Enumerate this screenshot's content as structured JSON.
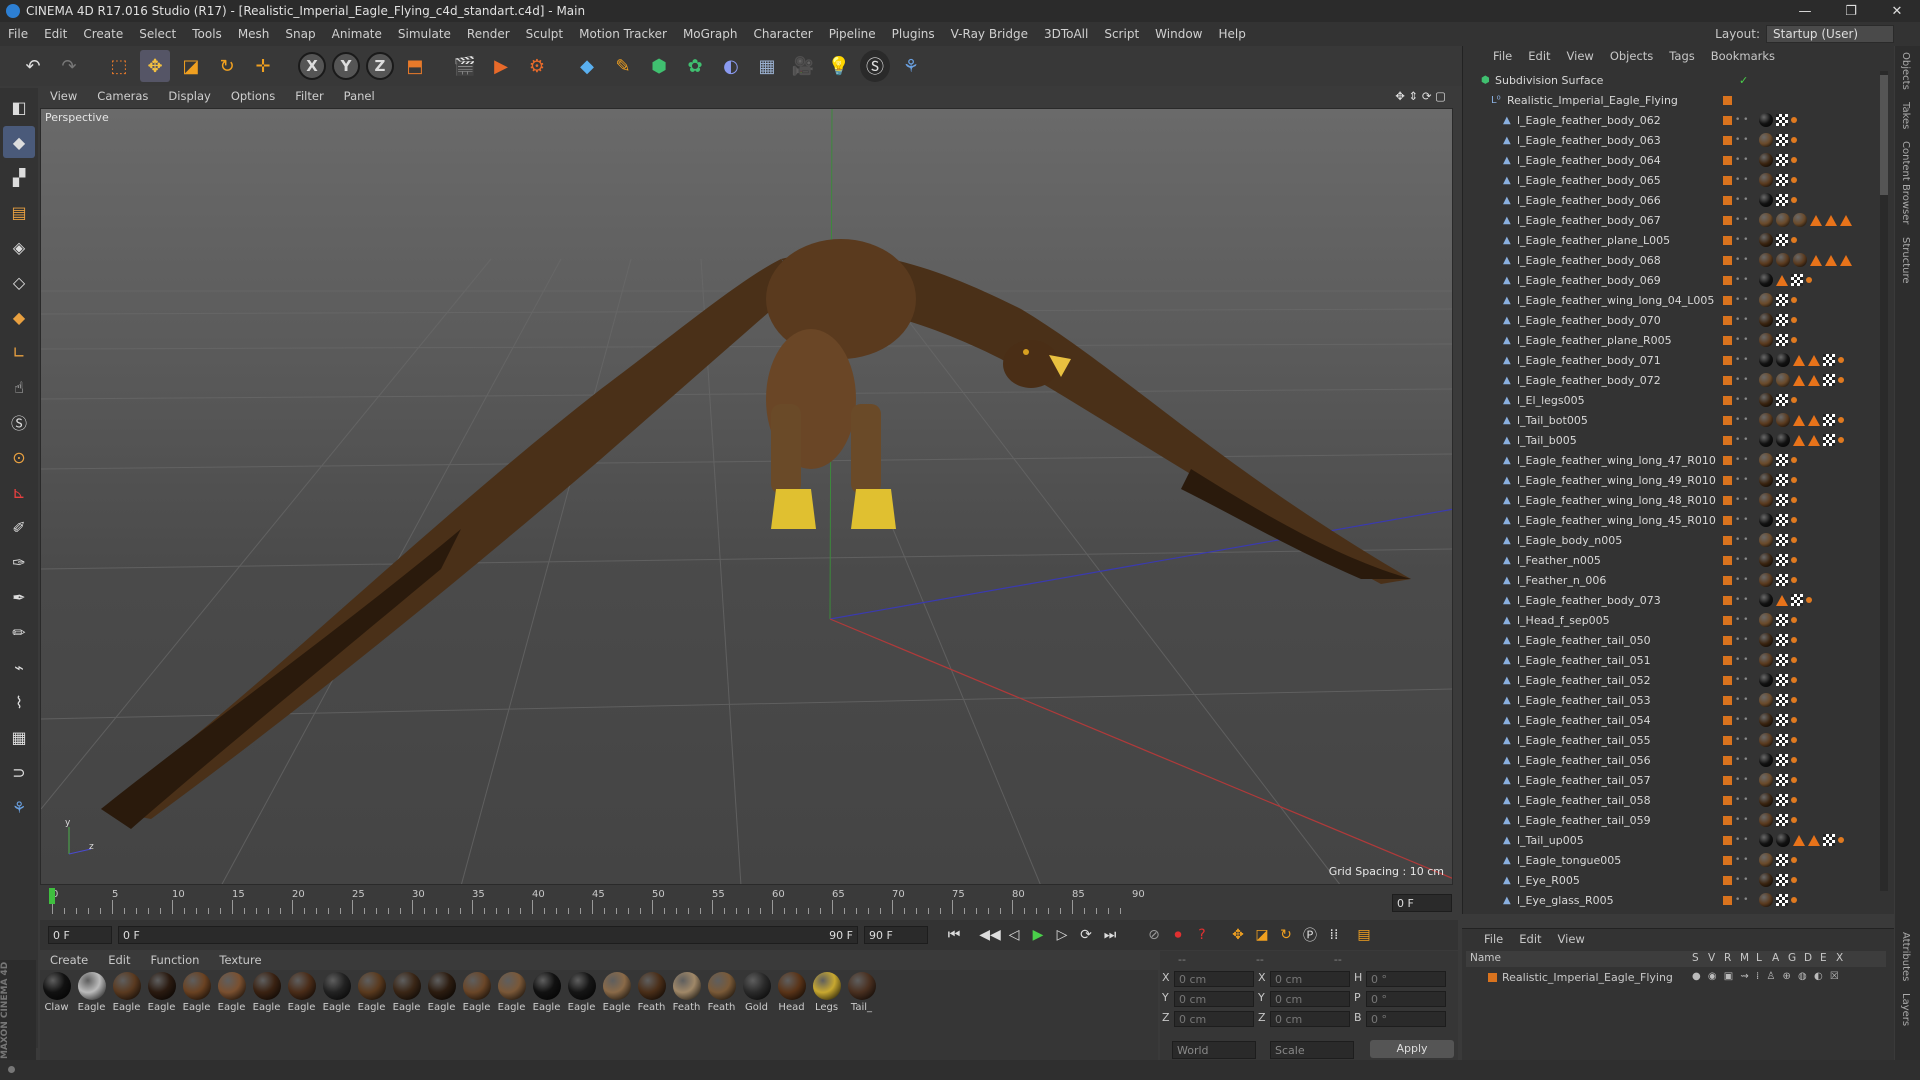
{
  "window": {
    "title": "CINEMA 4D R17.016 Studio (R17) - [Realistic_Imperial_Eagle_Flying_c4d_standart.c4d] - Main",
    "controls": [
      "—",
      "❐",
      "✕"
    ]
  },
  "menubar": [
    "File",
    "Edit",
    "Create",
    "Select",
    "Tools",
    "Mesh",
    "Snap",
    "Animate",
    "Simulate",
    "Render",
    "Sculpt",
    "Motion Tracker",
    "MoGraph",
    "Character",
    "Pipeline",
    "Plugins",
    "V-Ray Bridge",
    "3DToAll",
    "Script",
    "Window",
    "Help"
  ],
  "layout": {
    "label": "Layout:",
    "value": "Startup (User)"
  },
  "viewport": {
    "menu": [
      "View",
      "Cameras",
      "Display",
      "Options",
      "Filter",
      "Panel"
    ],
    "camera": "Perspective",
    "grid_spacing": "Grid Spacing : 10 cm"
  },
  "timeline": {
    "ticks": [
      "0",
      "5",
      "10",
      "15",
      "20",
      "25",
      "30",
      "35",
      "40",
      "45",
      "50",
      "55",
      "60",
      "65",
      "70",
      "75",
      "80",
      "85",
      "90"
    ],
    "current_frame": "0 F"
  },
  "playbar": {
    "start": "0 F",
    "range_start": "0 F",
    "range_end": "90 F",
    "end": "90 F"
  },
  "materials": {
    "menu": [
      "Create",
      "Edit",
      "Function",
      "Texture"
    ],
    "items": [
      {
        "name": "Claw",
        "color": "#111"
      },
      {
        "name": "Eagle",
        "color": "#bbb"
      },
      {
        "name": "Eagle",
        "color": "#5a3a20"
      },
      {
        "name": "Eagle",
        "color": "#2a1a10"
      },
      {
        "name": "Eagle",
        "color": "#6a4222"
      },
      {
        "name": "Eagle",
        "color": "#7a5030"
      },
      {
        "name": "Eagle",
        "color": "#3a2212"
      },
      {
        "name": "Eagle",
        "color": "#4a2c18"
      },
      {
        "name": "Eagle",
        "color": "#222"
      },
      {
        "name": "Eagle",
        "color": "#5a3a1e"
      },
      {
        "name": "Eagle",
        "color": "#3a2616"
      },
      {
        "name": "Eagle",
        "color": "#2c1c10"
      },
      {
        "name": "Eagle",
        "color": "#6a4628"
      },
      {
        "name": "Eagle",
        "color": "#7a5838"
      },
      {
        "name": "Eagle",
        "color": "#111"
      },
      {
        "name": "Eagle",
        "color": "#151515"
      },
      {
        "name": "Eagle",
        "color": "#8a6a48"
      },
      {
        "name": "Feath",
        "color": "#4a2e18"
      },
      {
        "name": "Feath",
        "color": "#a08868"
      },
      {
        "name": "Feath",
        "color": "#7a5a38"
      },
      {
        "name": "Gold",
        "color": "#2a2a2a"
      },
      {
        "name": "Head",
        "color": "#5a3418"
      },
      {
        "name": "Legs",
        "color": "#c8a830"
      },
      {
        "name": "Tail_",
        "color": "#4a3020"
      }
    ]
  },
  "coords": {
    "pos_label": "--",
    "size_label": "--",
    "rot_label": "--",
    "rows": [
      [
        "X",
        "0 cm",
        "X",
        "0 cm",
        "H",
        "0 °"
      ],
      [
        "Y",
        "0 cm",
        "Y",
        "0 cm",
        "P",
        "0 °"
      ],
      [
        "Z",
        "0 cm",
        "Z",
        "0 cm",
        "B",
        "0 °"
      ]
    ],
    "mode1": "World",
    "mode2": "Scale",
    "apply": "Apply"
  },
  "objects": {
    "menu": [
      "File",
      "Edit",
      "View",
      "Objects",
      "Tags",
      "Bookmarks"
    ],
    "root": "Subdivision Surface",
    "group": "Realistic_Imperial_Eagle_Flying",
    "items": [
      {
        "name": "l_Eagle_feather_body_062",
        "tags": "b"
      },
      {
        "name": "l_Eagle_feather_body_063",
        "tags": "b"
      },
      {
        "name": "l_Eagle_feather_body_064",
        "tags": "b"
      },
      {
        "name": "l_Eagle_feather_body_065",
        "tags": "b"
      },
      {
        "name": "l_Eagle_feather_body_066",
        "tags": "b"
      },
      {
        "name": "l_Eagle_feather_body_067",
        "tags": "big"
      },
      {
        "name": "l_Eagle_feather_plane_L005",
        "tags": "b"
      },
      {
        "name": "l_Eagle_feather_body_068",
        "tags": "big"
      },
      {
        "name": "l_Eagle_feather_body_069",
        "tags": "mid"
      },
      {
        "name": "l_Eagle_feather_wing_long_04_L005",
        "tags": "b"
      },
      {
        "name": "l_Eagle_feather_body_070",
        "tags": "b"
      },
      {
        "name": "l_Eagle_feather_plane_R005",
        "tags": "b"
      },
      {
        "name": "l_Eagle_feather_body_071",
        "tags": "big2"
      },
      {
        "name": "l_Eagle_feather_body_072",
        "tags": "big3"
      },
      {
        "name": "l_El_legs005",
        "tags": "b"
      },
      {
        "name": "l_Tail_bot005",
        "tags": "big2"
      },
      {
        "name": "l_Tail_b005",
        "tags": "big3"
      },
      {
        "name": "l_Eagle_feather_wing_long_47_R010",
        "tags": "b"
      },
      {
        "name": "l_Eagle_feather_wing_long_49_R010",
        "tags": "b"
      },
      {
        "name": "l_Eagle_feather_wing_long_48_R010",
        "tags": "b"
      },
      {
        "name": "l_Eagle_feather_wing_long_45_R010",
        "tags": "b"
      },
      {
        "name": "l_Eagle_body_n005",
        "tags": "b"
      },
      {
        "name": "l_Feather_n005",
        "tags": "b"
      },
      {
        "name": "l_Feather_n_006",
        "tags": "b"
      },
      {
        "name": "l_Eagle_feather_body_073",
        "tags": "mid"
      },
      {
        "name": "l_Head_f_sep005",
        "tags": "b"
      },
      {
        "name": "l_Eagle_feather_tail_050",
        "tags": "b"
      },
      {
        "name": "l_Eagle_feather_tail_051",
        "tags": "b"
      },
      {
        "name": "l_Eagle_feather_tail_052",
        "tags": "b"
      },
      {
        "name": "l_Eagle_feather_tail_053",
        "tags": "b"
      },
      {
        "name": "l_Eagle_feather_tail_054",
        "tags": "b"
      },
      {
        "name": "l_Eagle_feather_tail_055",
        "tags": "b"
      },
      {
        "name": "l_Eagle_feather_tail_056",
        "tags": "b"
      },
      {
        "name": "l_Eagle_feather_tail_057",
        "tags": "b"
      },
      {
        "name": "l_Eagle_feather_tail_058",
        "tags": "b"
      },
      {
        "name": "l_Eagle_feather_tail_059",
        "tags": "b"
      },
      {
        "name": "l_Tail_up005",
        "tags": "big2"
      },
      {
        "name": "l_Eagle_tongue005",
        "tags": "b"
      },
      {
        "name": "l_Eye_R005",
        "tags": "b"
      },
      {
        "name": "l_Eye_glass_R005",
        "tags": "b"
      }
    ]
  },
  "layers": {
    "menu": [
      "File",
      "Edit",
      "View"
    ],
    "header": [
      "Name",
      "S",
      "V",
      "R",
      "M",
      "L",
      "A",
      "G",
      "D",
      "E",
      "X"
    ],
    "item": "Realistic_Imperial_Eagle_Flying"
  },
  "sidetabs": [
    "Objects",
    "Takes",
    "Content Browser",
    "Structure"
  ],
  "sidetabs2": [
    "Attributes",
    "Layers"
  ],
  "branding": "MAXON CINEMA 4D"
}
